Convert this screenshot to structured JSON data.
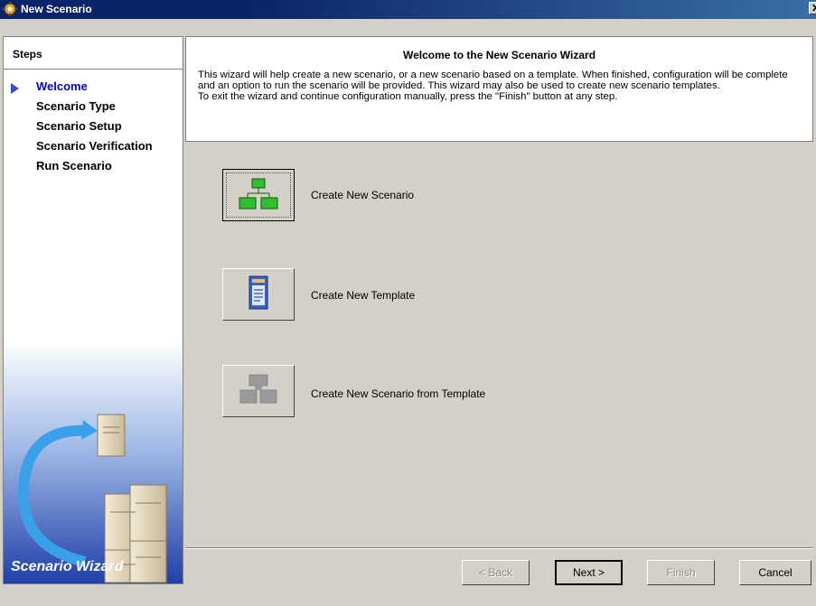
{
  "window": {
    "title": "New Scenario",
    "close_glyph": "✕"
  },
  "steps": {
    "header": "Steps",
    "items": [
      {
        "label": "Welcome",
        "active": true
      },
      {
        "label": "Scenario Type",
        "active": false
      },
      {
        "label": "Scenario Setup",
        "active": false
      },
      {
        "label": "Scenario Verification",
        "active": false
      },
      {
        "label": "Run Scenario",
        "active": false
      }
    ],
    "banner_text": "Scenario Wizard"
  },
  "welcome": {
    "title": "Welcome to the New Scenario Wizard",
    "paragraph1": "This wizard will help create a new scenario, or a new scenario based on a template.  When finished, configuration will be complete and an option to run the scenario will be provided.  This wizard may also be used to create new scenario templates.",
    "paragraph2": "To exit the wizard and continue configuration manually, press the \"Finish\" button at any step."
  },
  "options": [
    {
      "label": "Create New Scenario",
      "icon": "network-nodes-icon"
    },
    {
      "label": "Create New Template",
      "icon": "template-document-icon"
    },
    {
      "label": "Create New Scenario from Template",
      "icon": "scenario-from-template-icon"
    }
  ],
  "footer": {
    "back_label": "< Back",
    "next_label": "Next >",
    "finish_label": "Finish",
    "cancel_label": "Cancel"
  }
}
